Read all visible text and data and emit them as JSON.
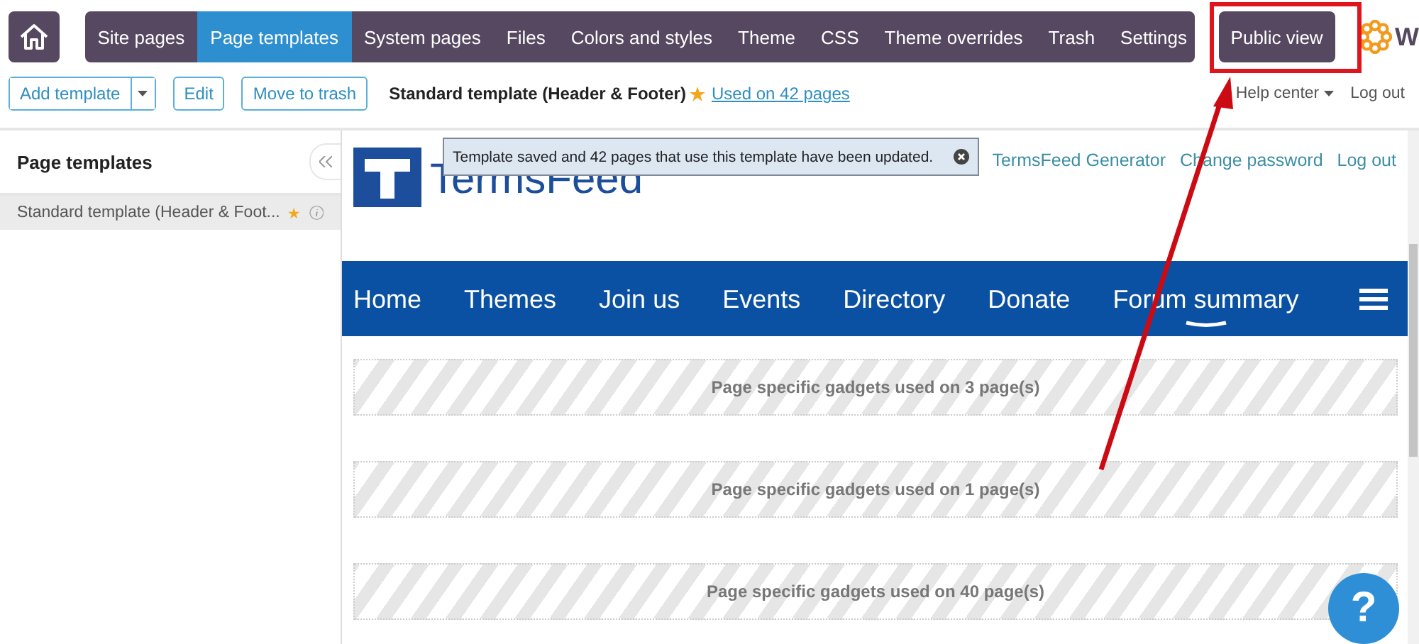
{
  "nav": {
    "items": [
      {
        "label": "Site pages",
        "selected": false
      },
      {
        "label": "Page templates",
        "selected": true
      },
      {
        "label": "System pages",
        "selected": false
      },
      {
        "label": "Files",
        "selected": false
      },
      {
        "label": "Colors and styles",
        "selected": false
      },
      {
        "label": "Theme",
        "selected": false
      },
      {
        "label": "CSS",
        "selected": false
      },
      {
        "label": "Theme overrides",
        "selected": false
      }
    ],
    "right_items": [
      {
        "label": "Trash",
        "selected": false
      },
      {
        "label": "Settings",
        "selected": false
      }
    ],
    "public_view": "Public view",
    "logo_text": "W"
  },
  "toolbar": {
    "add_button": "Add template",
    "edit_button": "Edit",
    "trash_button": "Move to trash",
    "template_name": "Standard template (Header & Footer)",
    "usage_link": "Used on 42 pages",
    "help_menu": "Help center",
    "logout": "Log out"
  },
  "sidebar": {
    "title": "Page templates",
    "items": [
      {
        "label": "Standard template (Header & Foot...",
        "selected": true
      }
    ]
  },
  "preview": {
    "logo_text": "TermsFeed",
    "links": [
      "TermsFeed Generator",
      "Change password",
      "Log out"
    ],
    "menu": [
      {
        "label": "Home",
        "selected": false
      },
      {
        "label": "Themes",
        "selected": false
      },
      {
        "label": "Join us",
        "selected": false
      },
      {
        "label": "Events",
        "selected": false
      },
      {
        "label": "Directory",
        "selected": false
      },
      {
        "label": "Donate",
        "selected": false
      },
      {
        "label": "Forum summary",
        "selected": true
      }
    ],
    "gadget_areas": [
      "Page specific gadgets used on 3 page(s)",
      "Page specific gadgets used on 1 page(s)",
      "Page specific gadgets used on 40 page(s)"
    ]
  },
  "toast": {
    "message": "Template saved and 42 pages that use this template have been updated."
  },
  "help_button": "?"
}
